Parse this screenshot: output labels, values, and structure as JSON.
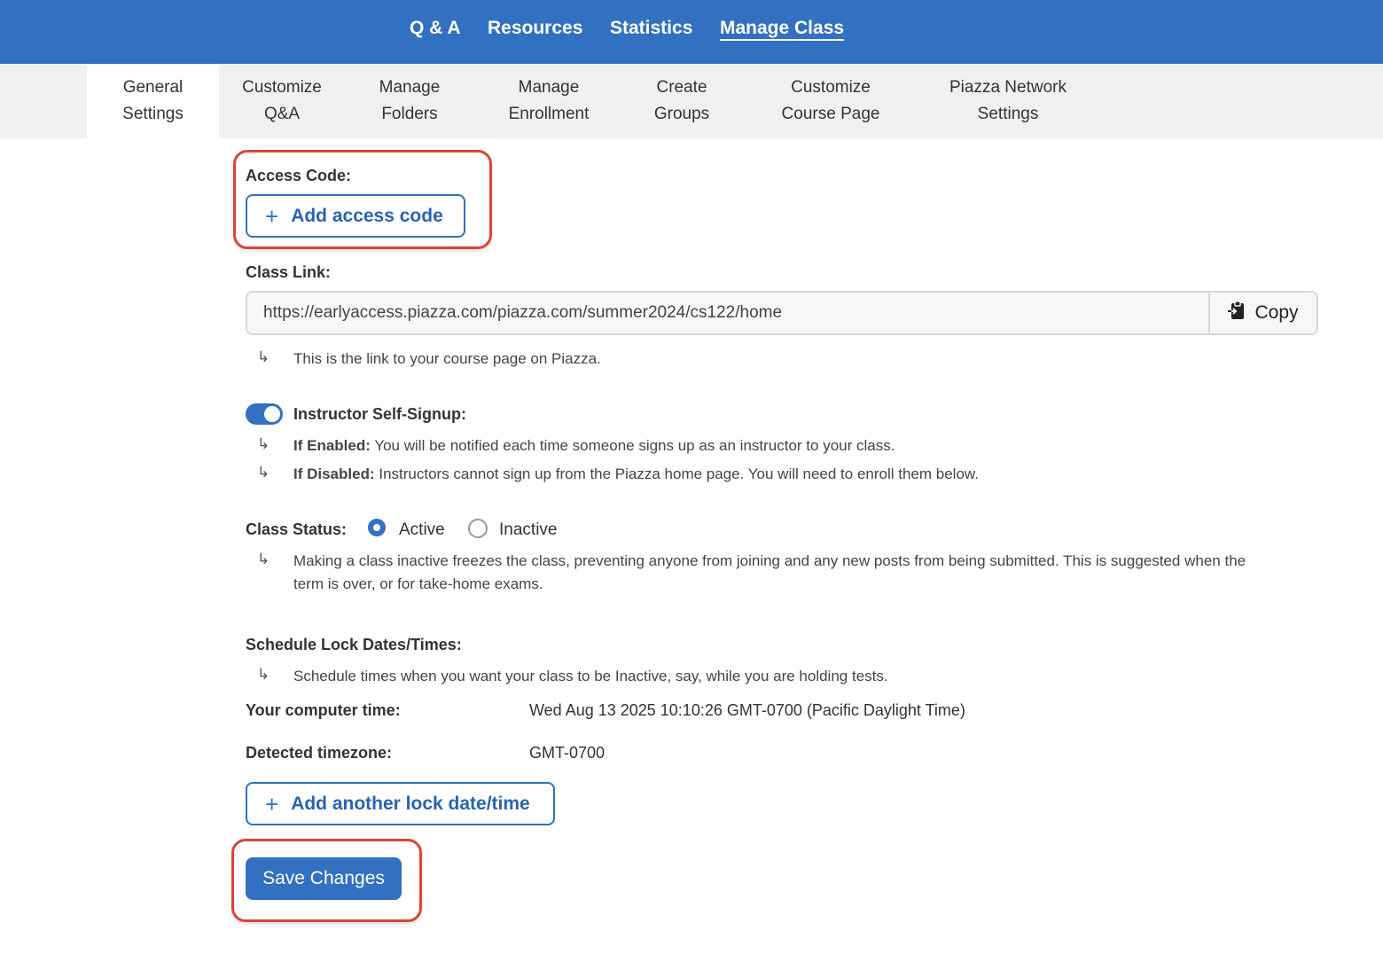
{
  "topnav": {
    "items": [
      {
        "label": "Q & A"
      },
      {
        "label": "Resources"
      },
      {
        "label": "Statistics"
      },
      {
        "label": "Manage Class",
        "active": true
      }
    ]
  },
  "subtabs": [
    {
      "line1": "General",
      "line2": "Settings",
      "active": true
    },
    {
      "line1": "Customize",
      "line2": "Q&A"
    },
    {
      "line1": "Manage",
      "line2": "Folders"
    },
    {
      "line1": "Manage",
      "line2": "Enrollment"
    },
    {
      "line1": "Create",
      "line2": "Groups"
    },
    {
      "line1": "Customize",
      "line2": "Course Page"
    },
    {
      "line1": "Piazza Network",
      "line2": "Settings"
    }
  ],
  "access_code": {
    "label": "Access Code:",
    "button": "Add access code"
  },
  "class_link": {
    "label": "Class Link:",
    "value": "https://earlyaccess.piazza.com/piazza.com/summer2024/cs122/home",
    "copy_label": "Copy",
    "hint": "This is the link to your course page on Piazza."
  },
  "self_signup": {
    "label": "Instructor Self-Signup:",
    "enabled": true,
    "enabled_prefix": "If Enabled:",
    "enabled_text": " You will be notified each time someone signs up as an instructor to your class.",
    "disabled_prefix": "If Disabled:",
    "disabled_text": " Instructors cannot sign up from the Piazza home page. You will need to enroll them below."
  },
  "class_status": {
    "label": "Class Status:",
    "options": [
      "Active",
      "Inactive"
    ],
    "selected": "Active",
    "hint_line1": "Making a class inactive freezes the class, preventing anyone from joining and any new posts from being submitted. This is suggested when the",
    "hint_line2": "term is over, or for take-home exams."
  },
  "schedule": {
    "label": "Schedule Lock Dates/Times:",
    "hint": "Schedule times when you want your class to be Inactive, say, while you are holding tests.",
    "computer_time_label": "Your computer time:",
    "computer_time_value": "Wed Aug 13 2025 10:10:26 GMT-0700 (Pacific Daylight Time)",
    "timezone_label": "Detected timezone:",
    "timezone_value": "GMT-0700",
    "add_button": "Add another lock date/time"
  },
  "save_button": "Save Changes",
  "arrow_glyph": "↳",
  "colors": {
    "brand": "#3270c1",
    "highlight": "#d9472f"
  }
}
